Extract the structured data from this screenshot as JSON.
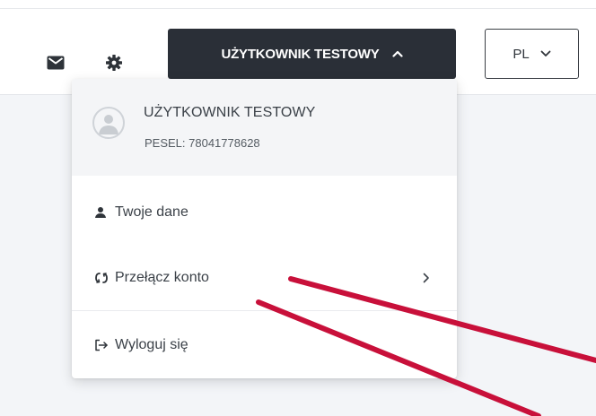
{
  "header": {
    "icons": {
      "mail": "mail-icon",
      "settings": "gear-icon"
    },
    "user_button": {
      "label": "UŻYTKOWNIK TESTOWY",
      "icon": "chevron-up-icon"
    },
    "language": {
      "label": "PL",
      "icon": "chevron-down-icon"
    }
  },
  "dropdown": {
    "profile": {
      "avatar_icon": "user-circle-icon",
      "name": "UŻYTKOWNIK TESTOWY",
      "pesel": "PESEL: 78041778628"
    },
    "items": [
      {
        "label": "Twoje dane",
        "icon": "person-icon"
      },
      {
        "label": "Przełącz konto",
        "icon": "switch-icon",
        "submenu_icon": "chevron-right-icon"
      },
      {
        "label": "Wyloguj się",
        "icon": "logout-icon"
      }
    ]
  },
  "colors": {
    "user_button_bg": "#2a2f37",
    "annotation_line": "#c8103a",
    "content_bg": "#f3f5f8"
  }
}
